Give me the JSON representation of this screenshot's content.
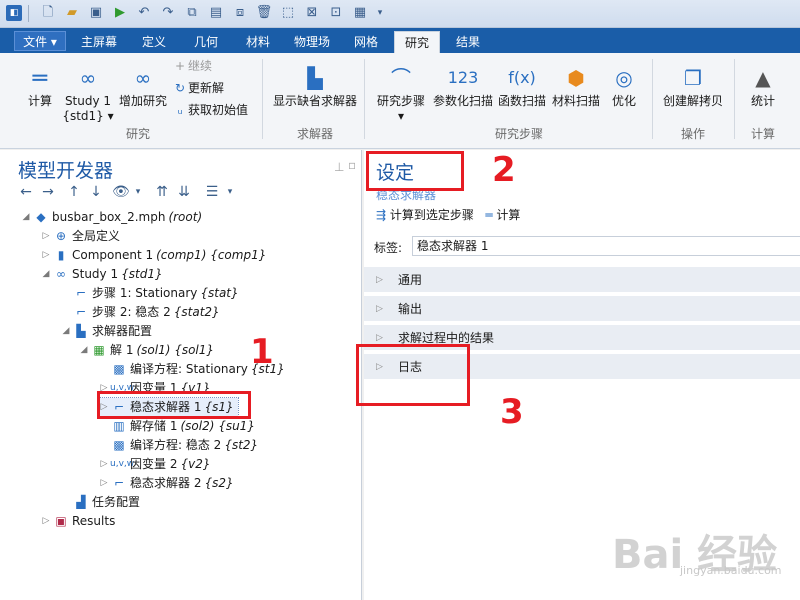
{
  "tabs": {
    "file": "文件 ▾",
    "items": [
      "主屏幕",
      "定义",
      "几何",
      "材料",
      "物理场",
      "网格",
      "研究",
      "结果"
    ],
    "active": "研究"
  },
  "ribbon": {
    "compute": "计算",
    "study": "Study 1",
    "study_sub": "{std1} ▾",
    "add_study": "增加研究",
    "continue": "继续",
    "update_solution": "更新解",
    "get_initial": "获取初始值",
    "group_study": "研究",
    "show_default_solver": "显示缺省求解器",
    "group_solver": "求解器",
    "study_steps": "研究步骤",
    "study_steps_sub": "▾",
    "param_sweep": "参数化扫描",
    "func_sweep": "函数扫描",
    "mat_sweep": "材料扫描",
    "optimize": "优化",
    "group_study_steps": "研究步骤",
    "create_copy": "创建解拷贝",
    "group_operation": "操作",
    "statistics": "统计",
    "group_compute": "计算"
  },
  "left": {
    "title": "模型开发器",
    "tree": [
      {
        "t": "busbar_box_2.mph",
        "s": "(root)"
      },
      {
        "t": "全局定义",
        "s": ""
      },
      {
        "t": "Component 1",
        "s": "(comp1) {comp1}"
      },
      {
        "t": "Study 1",
        "s": "{std1}"
      },
      {
        "t": "步骤 1: Stationary",
        "s": "{stat}"
      },
      {
        "t": "步骤 2: 稳态 2",
        "s": "{stat2}"
      },
      {
        "t": "求解器配置",
        "s": ""
      },
      {
        "t": "解 1",
        "s": "(sol1) {sol1}"
      },
      {
        "t": "编译方程: Stationary",
        "s": "{st1}"
      },
      {
        "t": "因变量 1",
        "s": "{v1}"
      },
      {
        "t": "稳态求解器 1",
        "s": "{s1}"
      },
      {
        "t": "解存储 1",
        "s": "(sol2) {su1}"
      },
      {
        "t": "编译方程: 稳态 2",
        "s": "{st2}"
      },
      {
        "t": "因变量 2",
        "s": "{v2}"
      },
      {
        "t": "稳态求解器 2",
        "s": "{s2}"
      },
      {
        "t": "任务配置",
        "s": ""
      },
      {
        "t": "Results",
        "s": ""
      }
    ]
  },
  "right": {
    "title": "设定",
    "subtitle": "稳态求解器",
    "compute_to_selected": "计算到选定步骤",
    "compute": "计算",
    "label_caption": "标签:",
    "label_value": "稳态求解器 1",
    "sections": [
      "通用",
      "输出",
      "求解过程中的结果",
      "日志"
    ]
  },
  "annotations": {
    "n1": "1",
    "n2": "2",
    "n3": "3"
  },
  "watermark": {
    "main": "Bai 经验",
    "sub": "jingyan.baidu.com"
  },
  "colors": {
    "accent": "#1f5aa6",
    "tabbar": "#1a5da8",
    "annotation": "#e61c23"
  }
}
